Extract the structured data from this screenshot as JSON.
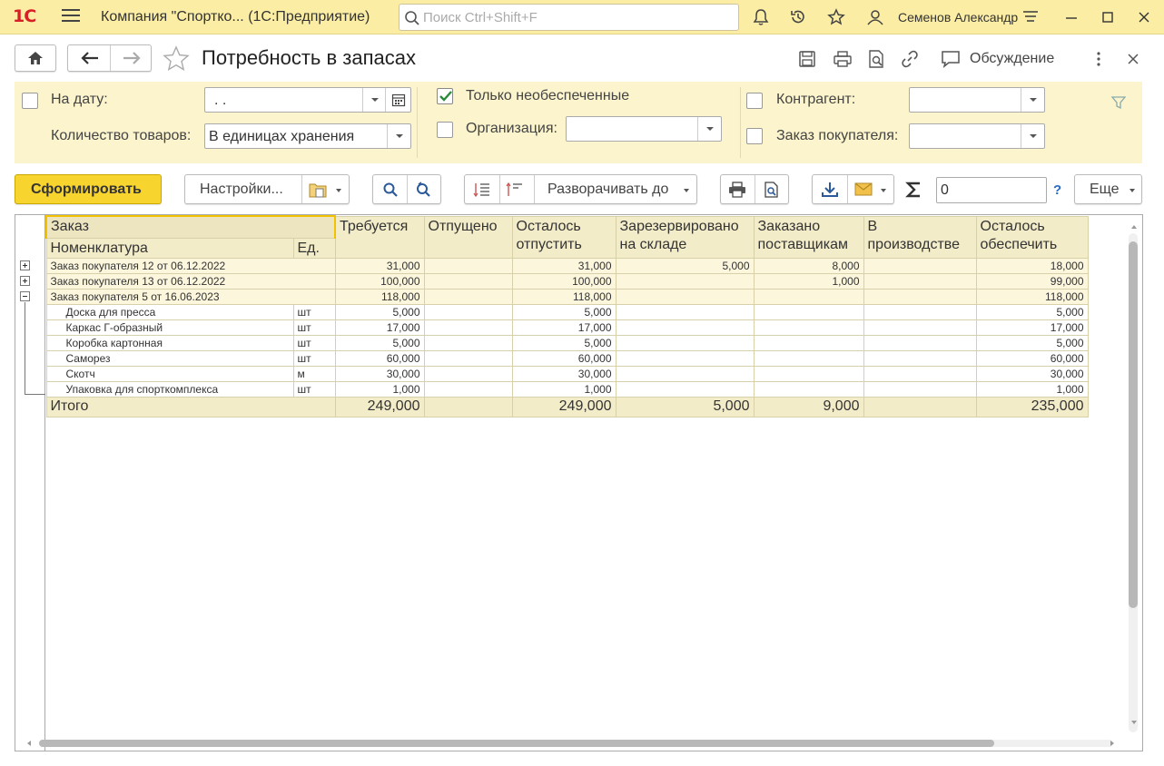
{
  "titlebar": {
    "logo": "1С",
    "title": "Компания \"Спортко...  (1С:Предприятие)",
    "search_placeholder": "Поиск Ctrl+Shift+F",
    "username": "Семенов Александр"
  },
  "header": {
    "title": "Потребность в запасах",
    "discuss_label": "Обсуждение"
  },
  "filters": {
    "date_label": "На дату:",
    "date_value": " .  .",
    "qty_label": "Количество товаров:",
    "qty_value": "В единицах хранения",
    "only_unsecured_label": "Только необеспеченные",
    "organization_label": "Организация:",
    "contractor_label": "Контрагент:",
    "customer_order_label": "Заказ покупателя:"
  },
  "toolbar": {
    "generate_label": "Сформировать",
    "settings_label": "Настройки...",
    "expand_label": "Разворачивать до",
    "sum_value": "0",
    "help_label": "?",
    "more_label": "Еще"
  },
  "report": {
    "columns": {
      "order": "Заказ",
      "nomenclature": "Номенклатура",
      "unit": "Ед.",
      "required": "Требуется",
      "released": "Отпущено",
      "remaining_release_1": "Осталось",
      "remaining_release_2": "отпустить",
      "reserved_1": "Зарезервировано",
      "reserved_2": "на складе",
      "ordered_1": "Заказано",
      "ordered_2": "поставщикам",
      "production_1": "В",
      "production_2": "производстве",
      "remaining_secure_1": "Осталось",
      "remaining_secure_2": "обеспечить"
    },
    "groups": [
      {
        "name": "Заказ покупателя 12 от 06.12.2022",
        "required": "31,000",
        "released": "",
        "remaining_release": "31,000",
        "reserved": "5,000",
        "ordered": "8,000",
        "production": "",
        "remaining_secure": "18,000"
      },
      {
        "name": "Заказ покупателя 13 от 06.12.2022",
        "required": "100,000",
        "released": "",
        "remaining_release": "100,000",
        "reserved": "",
        "ordered": "1,000",
        "production": "",
        "remaining_secure": "99,000"
      },
      {
        "name": "Заказ покупателя 5 от 16.06.2023",
        "required": "118,000",
        "released": "",
        "remaining_release": "118,000",
        "reserved": "",
        "ordered": "",
        "production": "",
        "remaining_secure": "118,000"
      }
    ],
    "items": [
      {
        "name": "Доска для пресса",
        "unit": "шт",
        "required": "5,000",
        "remaining_release": "5,000",
        "remaining_secure": "5,000"
      },
      {
        "name": "Каркас Г-образный",
        "unit": "шт",
        "required": "17,000",
        "remaining_release": "17,000",
        "remaining_secure": "17,000"
      },
      {
        "name": "Коробка картонная",
        "unit": "шт",
        "required": "5,000",
        "remaining_release": "5,000",
        "remaining_secure": "5,000"
      },
      {
        "name": "Саморез",
        "unit": "шт",
        "required": "60,000",
        "remaining_release": "60,000",
        "remaining_secure": "60,000"
      },
      {
        "name": "Скотч",
        "unit": "м",
        "required": "30,000",
        "remaining_release": "30,000",
        "remaining_secure": "30,000"
      },
      {
        "name": "Упаковка для спорткомплекса",
        "unit": "шт",
        "required": "1,000",
        "remaining_release": "1,000",
        "remaining_secure": "1,000"
      }
    ],
    "total": {
      "label": "Итого",
      "required": "249,000",
      "released": "",
      "remaining_release": "249,000",
      "reserved": "5,000",
      "ordered": "9,000",
      "production": "",
      "remaining_secure": "235,000"
    }
  }
}
